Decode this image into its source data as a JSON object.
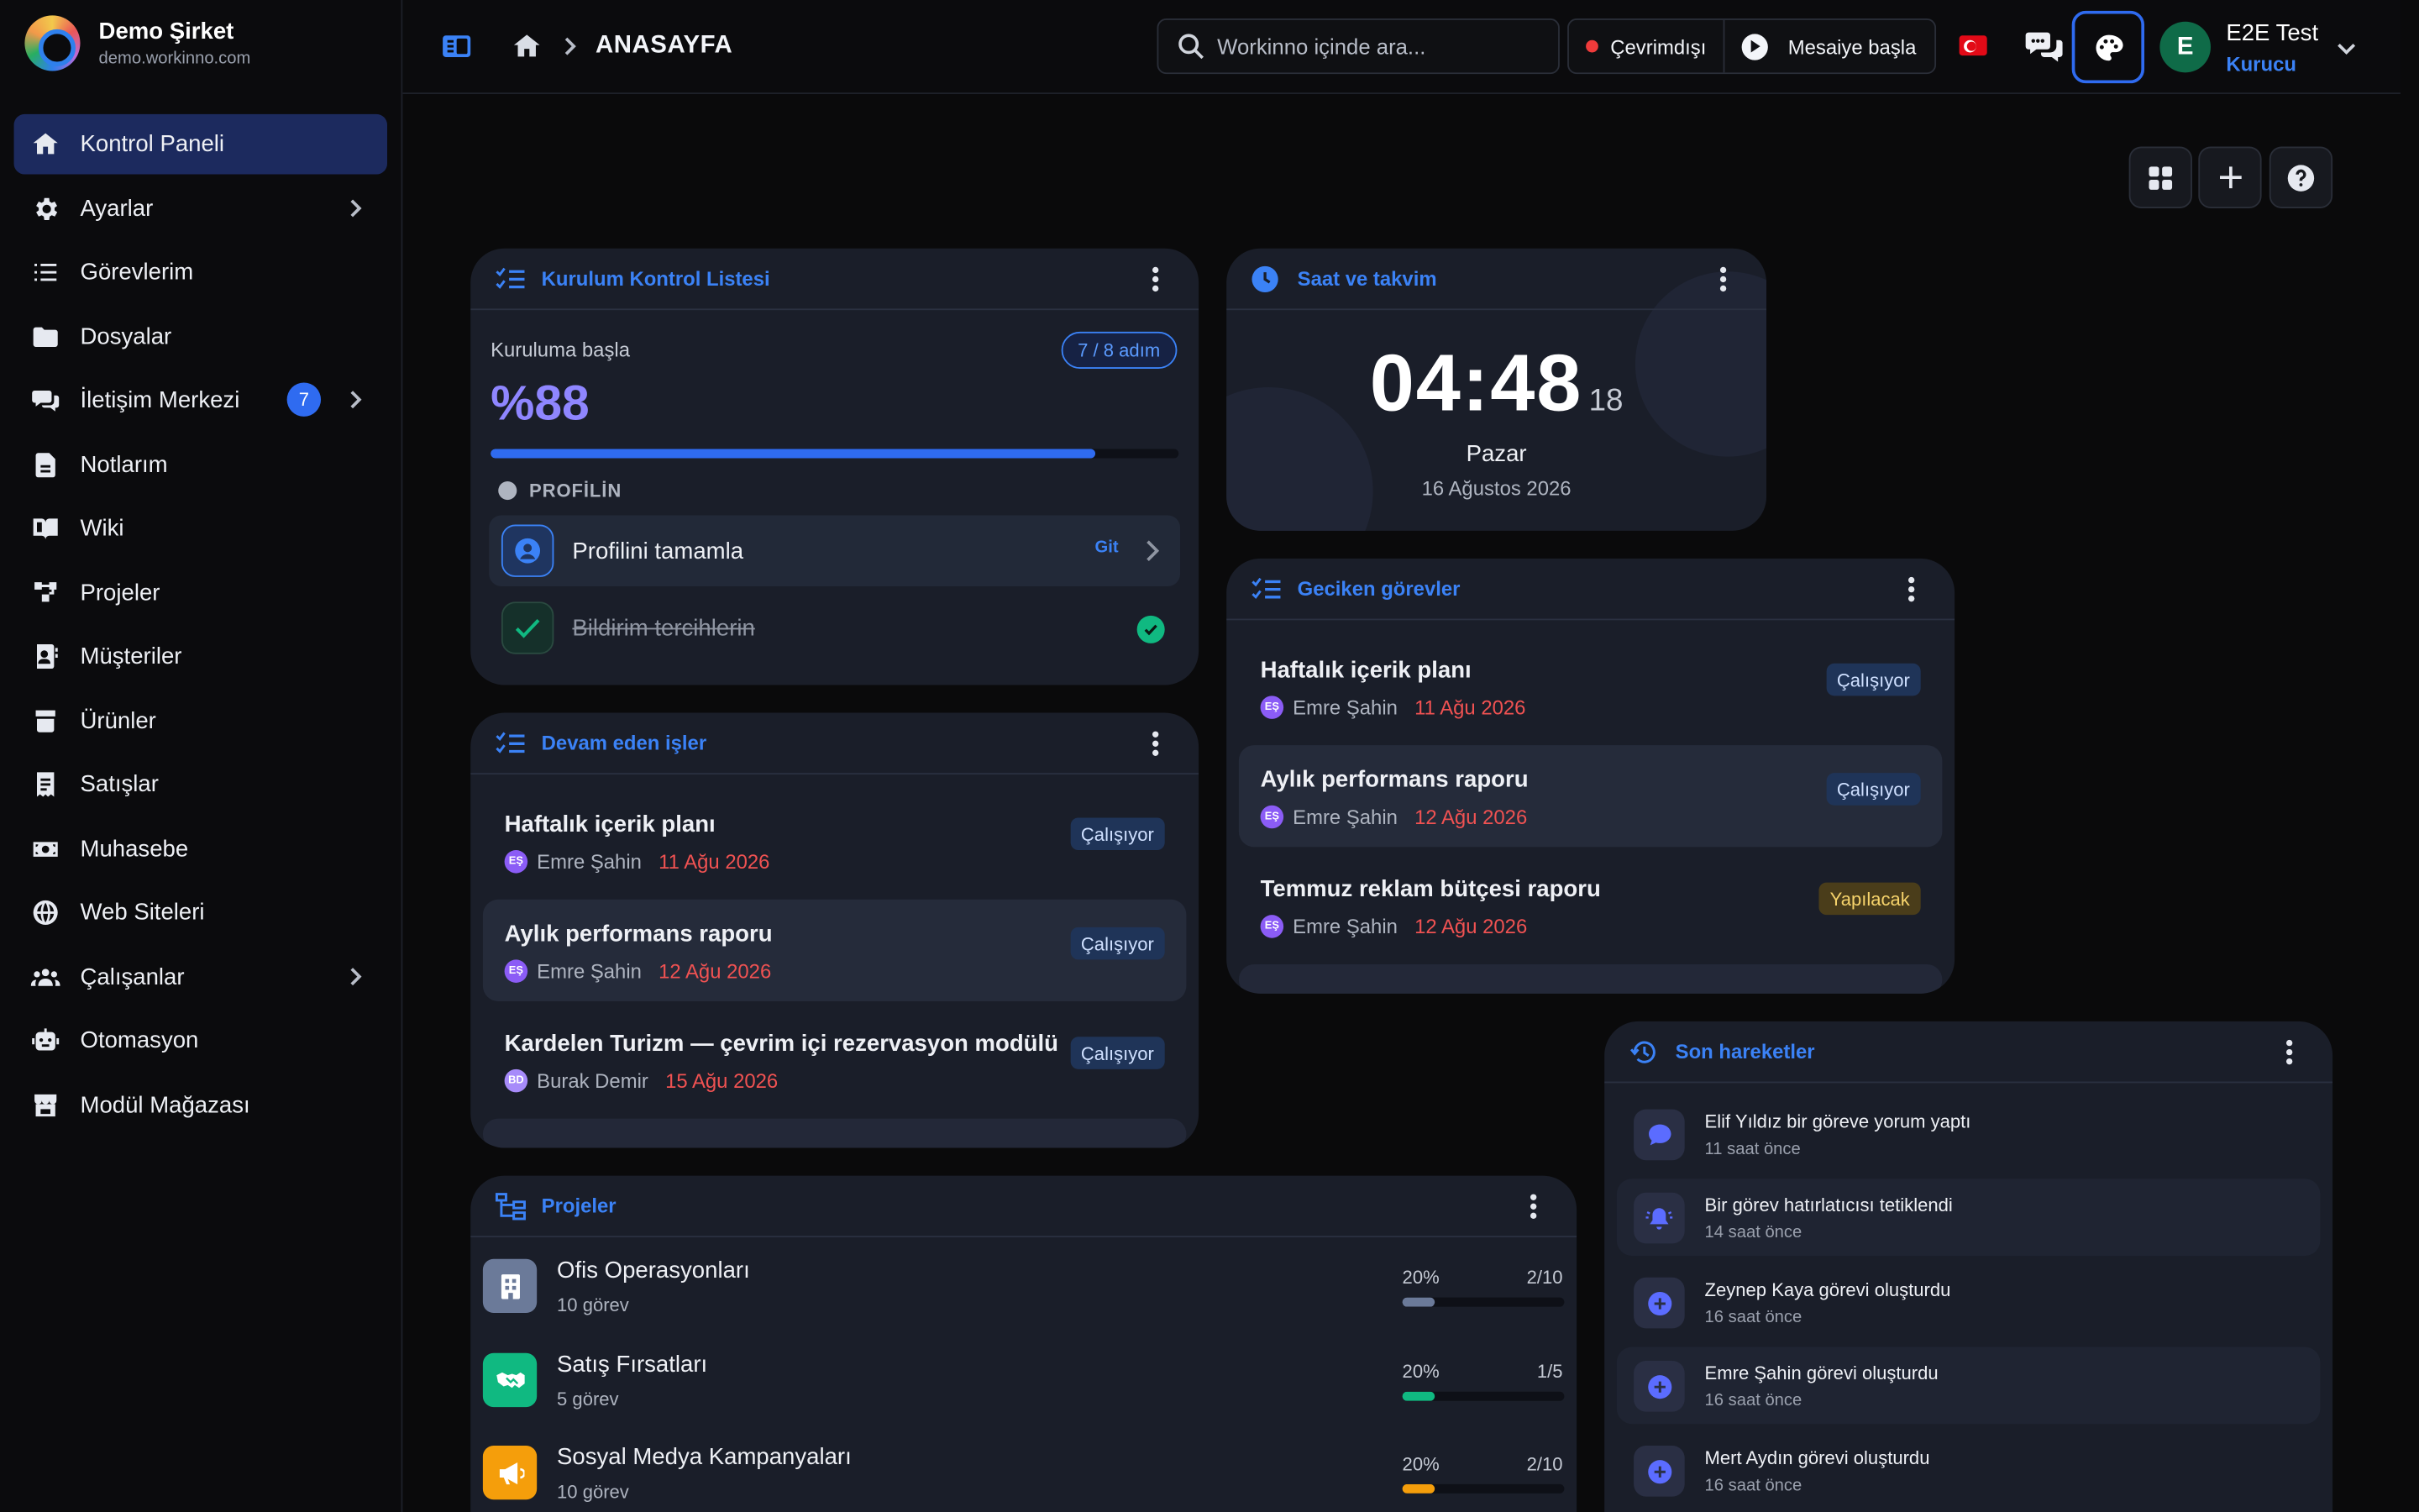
{
  "brand": {
    "name": "Demo Şirket",
    "domain": "demo.workinno.com"
  },
  "sidebar": {
    "items": [
      {
        "label": "Kontrol Paneli",
        "icon": "home-icon"
      },
      {
        "label": "Ayarlar",
        "icon": "gear-icon"
      },
      {
        "label": "Görevlerim",
        "icon": "task-list-icon"
      },
      {
        "label": "Dosyalar",
        "icon": "folder-icon"
      },
      {
        "label": "İletişim Merkezi",
        "icon": "chat-icon",
        "badge": "7"
      },
      {
        "label": "Notlarım",
        "icon": "note-icon"
      },
      {
        "label": "Wiki",
        "icon": "book-icon"
      },
      {
        "label": "Projeler",
        "icon": "project-icon"
      },
      {
        "label": "Müşteriler",
        "icon": "contact-icon"
      },
      {
        "label": "Ürünler",
        "icon": "box-icon"
      },
      {
        "label": "Satışlar",
        "icon": "receipt-icon"
      },
      {
        "label": "Muhasebe",
        "icon": "money-icon"
      },
      {
        "label": "Web Siteleri",
        "icon": "globe-icon"
      },
      {
        "label": "Çalışanlar",
        "icon": "users-icon"
      },
      {
        "label": "Otomasyon",
        "icon": "robot-icon"
      },
      {
        "label": "Modül Mağazası",
        "icon": "store-icon"
      }
    ]
  },
  "topbar": {
    "breadcrumb": "ANASAYFA",
    "search_placeholder": "Workinno içinde ara...",
    "status_offline": "Çevrimdışı",
    "start_shift": "Mesaiye başla",
    "user": {
      "initial": "E",
      "name": "E2E Test",
      "role": "Kurucu"
    }
  },
  "setup_card": {
    "title": "Kurulum Kontrol Listesi",
    "label": "Kuruluma başla",
    "steps": "7 / 8 adım",
    "percent_text": "%88",
    "progress_percent": 88,
    "section": "PROFİLİN",
    "items": [
      {
        "label": "Profilini tamamla",
        "action": "Git",
        "done": false
      },
      {
        "label": "Bildirim tercihlerin",
        "done": true
      }
    ]
  },
  "clock_card": {
    "title": "Saat ve takvim",
    "time_hm": "04:48",
    "time_s": "18",
    "day": "Pazar",
    "date": "16 Ağustos 2026"
  },
  "ongoing_card": {
    "title": "Devam eden işler",
    "tasks": [
      {
        "title": "Haftalık içerik planı",
        "initials": "EŞ",
        "person": "Emre Şahin",
        "date": "11 Ağu 2026",
        "status": "Çalışıyor"
      },
      {
        "title": "Aylık performans raporu",
        "initials": "EŞ",
        "person": "Emre Şahin",
        "date": "12 Ağu 2026",
        "status": "Çalışıyor"
      },
      {
        "title": "Kardelen Turizm — çevrim içi rezervasyon modülü",
        "initials": "BD",
        "person": "Burak Demir",
        "date": "15 Ağu 2026",
        "status": "Çalışıyor"
      }
    ]
  },
  "overdue_card": {
    "title": "Geciken görevler",
    "tasks": [
      {
        "title": "Haftalık içerik planı",
        "initials": "EŞ",
        "person": "Emre Şahin",
        "date": "11 Ağu 2026",
        "status": "Çalışıyor"
      },
      {
        "title": "Aylık performans raporu",
        "initials": "EŞ",
        "person": "Emre Şahin",
        "date": "12 Ağu 2026",
        "status": "Çalışıyor"
      },
      {
        "title": "Temmuz reklam bütçesi raporu",
        "initials": "EŞ",
        "person": "Emre Şahin",
        "date": "12 Ağu 2026",
        "status": "Yapılacak"
      }
    ]
  },
  "projects_card": {
    "title": "Projeler",
    "projects": [
      {
        "name": "Ofis Operasyonları",
        "count": "10 görev",
        "pct": "20%",
        "frac": "2/10",
        "progress": 20,
        "color": "#6b7a99"
      },
      {
        "name": "Satış Fırsatları",
        "count": "5 görev",
        "pct": "20%",
        "frac": "1/5",
        "progress": 20,
        "color": "#10b981"
      },
      {
        "name": "Sosyal Medya Kampanyaları",
        "count": "10 görev",
        "pct": "20%",
        "frac": "2/10",
        "progress": 20,
        "color": "#f59e0b"
      }
    ]
  },
  "activity_card": {
    "title": "Son hareketler",
    "items": [
      {
        "text": "Elif Yıldız bir göreve yorum yaptı",
        "time": "11 saat önce"
      },
      {
        "text": "Bir görev hatırlatıcısı tetiklendi",
        "time": "14 saat önce"
      },
      {
        "text": "Zeynep Kaya görevi oluşturdu",
        "time": "16 saat önce"
      },
      {
        "text": "Emre Şahin görevi oluşturdu",
        "time": "16 saat önce"
      },
      {
        "text": "Mert Aydın görevi oluşturdu",
        "time": "16 saat önce"
      }
    ]
  },
  "colors": {
    "accent": "#3b82f6",
    "card": "#1a1e29",
    "danger": "#f05252",
    "success": "#10b981"
  }
}
